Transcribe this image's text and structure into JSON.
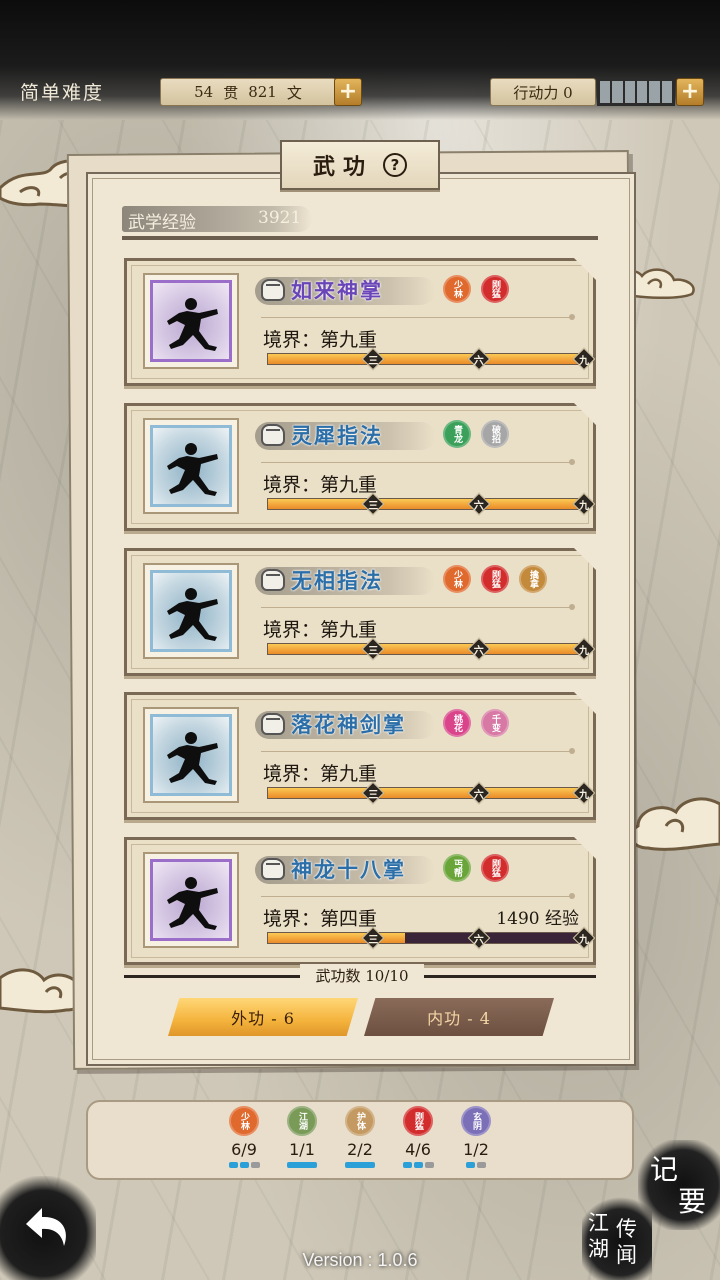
{
  "header": {
    "difficulty": "简单难度",
    "money": {
      "guan": "54",
      "guan_unit": "贯",
      "wen": "821",
      "wen_unit": "文"
    },
    "action_points_label": "行动力 0",
    "action_slots_total": 6,
    "action_slots_filled": 0
  },
  "panel": {
    "title": "武功",
    "help": "?",
    "exp_label": "武学经验",
    "exp_value": "3921"
  },
  "skills": [
    {
      "name": "如来神掌",
      "realm": "境界：第九重",
      "exp": "",
      "progress": 1.0,
      "frame": "purple",
      "name_color": "purple",
      "tags": [
        {
          "text": "少林",
          "color": "#e0692d"
        },
        {
          "text": "刚猛",
          "color": "#d22c2c"
        }
      ]
    },
    {
      "name": "灵犀指法",
      "realm": "境界：第九重",
      "exp": "",
      "progress": 1.0,
      "frame": "blue",
      "name_color": "blue",
      "tags": [
        {
          "text": "青龙",
          "color": "#3aa05a"
        },
        {
          "text": "破招",
          "color": "#a6a6a6"
        }
      ]
    },
    {
      "name": "无相指法",
      "realm": "境界：第九重",
      "exp": "",
      "progress": 1.0,
      "frame": "blue",
      "name_color": "blue",
      "tags": [
        {
          "text": "少林",
          "color": "#e0692d"
        },
        {
          "text": "刚猛",
          "color": "#d22c2c"
        },
        {
          "text": "擒拿",
          "color": "#c48a3c"
        }
      ]
    },
    {
      "name": "落花神剑掌",
      "realm": "境界：第九重",
      "exp": "",
      "progress": 1.0,
      "frame": "blue",
      "name_color": "blue",
      "tags": [
        {
          "text": "桃花",
          "color": "#d9448a"
        },
        {
          "text": "千变",
          "color": "#d878a4"
        }
      ]
    },
    {
      "name": "神龙十八掌",
      "realm": "境界：第四重",
      "exp": "1490 经验",
      "progress": 0.435,
      "frame": "purple",
      "name_color": "blue",
      "tags": [
        {
          "text": "丐帮",
          "color": "#6aa53a"
        },
        {
          "text": "刚猛",
          "color": "#d22c2c"
        }
      ]
    }
  ],
  "realm_markers": [
    "三",
    "六",
    "九"
  ],
  "skill_count_label": "武功数 10/10",
  "tabs": {
    "outer": "外功 - 6",
    "inner": "内功 - 4"
  },
  "sects": [
    {
      "text": "少林",
      "color": "#e0692d",
      "count": "6/9",
      "pips": [
        1,
        1,
        0
      ]
    },
    {
      "text": "江湖",
      "color": "#7a9a58",
      "count": "1/1",
      "pips": [
        2
      ]
    },
    {
      "text": "护体",
      "color": "#c49a62",
      "count": "2/2",
      "pips": [
        2
      ]
    },
    {
      "text": "刚猛",
      "color": "#d22c2c",
      "count": "4/6",
      "pips": [
        1,
        1,
        0
      ]
    },
    {
      "text": "玄阴",
      "color": "#7b6fb8",
      "count": "1/2",
      "pips": [
        1,
        0
      ]
    }
  ],
  "buttons": {
    "memo_1": "记",
    "memo_2": "要",
    "rumor_col1": "江湖",
    "rumor_col2": "传闻"
  },
  "version": "Version : 1.0.6"
}
